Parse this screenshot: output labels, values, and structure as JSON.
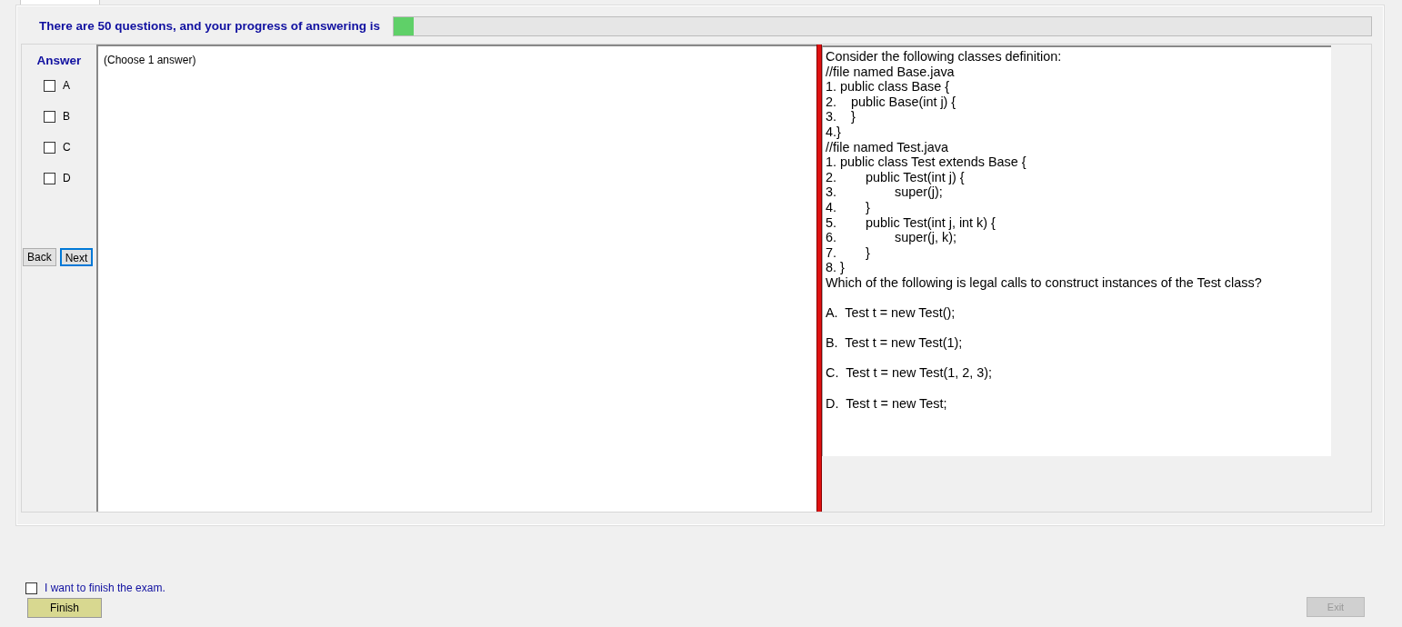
{
  "header": {
    "text": "There are 50 questions, and your progress of answering is",
    "progress": {
      "level": 0.02
    }
  },
  "answer_panel": {
    "title": "Answer",
    "choices": [
      {
        "label": "A",
        "checked": false
      },
      {
        "label": "B",
        "checked": false
      },
      {
        "label": "C",
        "checked": false
      },
      {
        "label": "D",
        "checked": false
      }
    ],
    "buttons": [
      {
        "label": "Back",
        "selected": false
      },
      {
        "label": "Next",
        "selected": true
      }
    ]
  },
  "answer_area": {
    "hint": "(Choose 1 answer)"
  },
  "question": {
    "lines": [
      "Consider the following classes definition:",
      "//file named Base.java",
      "1. public class Base {",
      "2.    public Base(int j) {",
      "3.    }",
      "4.}",
      "//file named Test.java",
      "1. public class Test extends Base {",
      "2.        public Test(int j) {",
      "3.                super(j);",
      "4.        }",
      "5.        public Test(int j, int k) {",
      "6.                super(j, k);",
      "7.        }",
      "8. }",
      "Which of the following is legal calls to construct instances of the Test class?"
    ],
    "options": [
      "A.  Test t = new Test();",
      "B.  Test t = new Test(1);",
      "C.  Test t = new Test(1, 2, 3);",
      "D.  Test t = new Test;"
    ]
  },
  "finish": {
    "label": "I want to finish the exam.",
    "checked": false,
    "button": "Finish"
  },
  "exit_button": {
    "label": "Exit",
    "disabled": true
  }
}
